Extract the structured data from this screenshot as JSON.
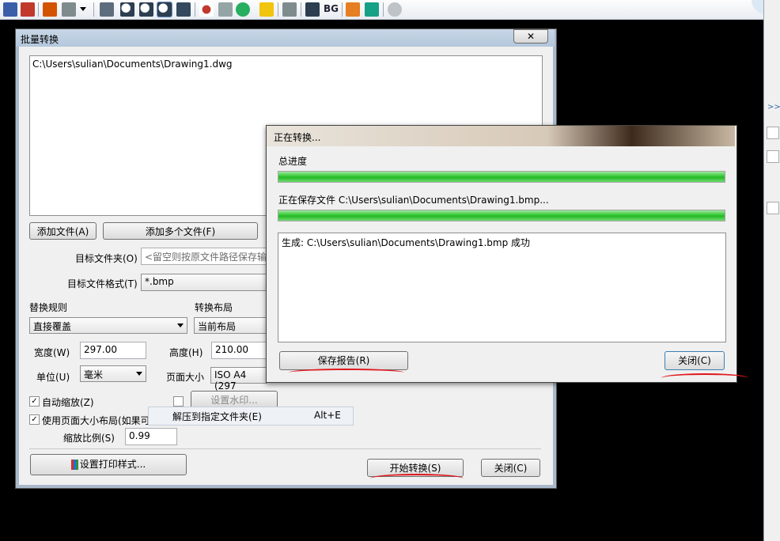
{
  "toolbar": {
    "bg_label": "BG"
  },
  "batch_dialog": {
    "title": "批量转换",
    "close_glyph": "✕",
    "file_list": [
      "C:\\Users\\sulian\\Documents\\Drawing1.dwg"
    ],
    "add_file": "添加文件(A)",
    "add_multiple": "添加多个文件(F)",
    "target_folder_label": "目标文件夹(O)",
    "target_folder_placeholder": "<留空则按原文件路径保存输",
    "target_format_label": "目标文件格式(T)",
    "target_format_value": "*.bmp",
    "replace_rule_label": "替换规则",
    "replace_rule_value": "直接覆盖",
    "layout_label": "转换布局",
    "layout_value": "当前布局",
    "width_label": "宽度(W)",
    "width_value": "297.00",
    "height_label": "高度(H)",
    "height_value": "210.00",
    "unit_label": "单位(U)",
    "unit_value": "毫米",
    "page_size_label": "页面大小",
    "page_size_value": "ISO A4 (297",
    "auto_scale": "自动缩放(Z)",
    "use_page_layout": "使用页面大小布局(如果可能)",
    "watermark_button": "设置水印...",
    "scale_label": "缩放比例(S)",
    "scale_value": "0.99",
    "print_style_button": "设置打印样式...",
    "start_button": "开始转换(S)",
    "close_button": "关闭(C)"
  },
  "context_menu": {
    "item_label": "解压到指定文件夹(E)",
    "item_shortcut": "Alt+E"
  },
  "progress_dialog": {
    "title": "正在转换...",
    "total_label": "总进度",
    "total_progress": 1.0,
    "saving_label": "正在保存文件 C:\\Users\\sulian\\Documents\\Drawing1.bmp...",
    "file_progress": 1.0,
    "log_text": "生成: C:\\Users\\sulian\\Documents\\Drawing1.bmp 成功",
    "save_report_button": "保存报告(R)",
    "close_button": "关闭(C)"
  },
  "right_strip": {
    "expand_glyph": ">>"
  },
  "colors": {
    "progress_green": "#24b824",
    "annotation_red": "#e0161b",
    "title_blue": "#b4c7dc"
  }
}
